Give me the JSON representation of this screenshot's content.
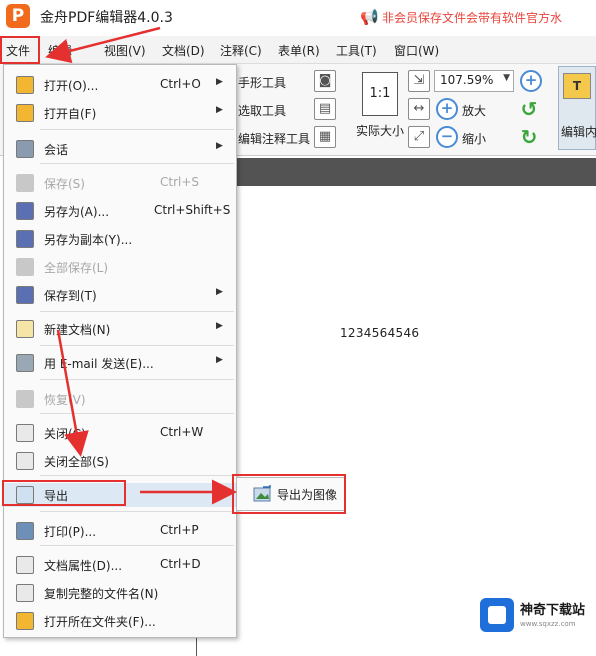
{
  "app": {
    "logo_letter": "P",
    "title": "金舟PDF编辑器4.0.3",
    "notice": "非会员保存文件会带有软件官方水"
  },
  "menubar": [
    "文件",
    "编辑",
    "视图(V)",
    "文档(D)",
    "注释(C)",
    "表单(R)",
    "工具(T)",
    "窗口(W)"
  ],
  "ribbon": {
    "hand_tool": "手形工具",
    "select_tool": "选取工具",
    "edit_annotation_tool": "编辑注释工具",
    "actual_size": "实际大小",
    "actual_size_icon_text": "1:1",
    "zoom_value": "107.59%",
    "zoom_in": "放大",
    "zoom_out": "缩小",
    "edit_content": "编辑内"
  },
  "file_menu": {
    "items": [
      {
        "label": "打开(O)...",
        "shortcut": "Ctrl+O",
        "submenu": true,
        "icon": "folder-open-icon",
        "disabled": false
      },
      {
        "label": "打开自(F)",
        "shortcut": "",
        "submenu": true,
        "icon": "folder-cloud-icon",
        "disabled": false
      },
      {
        "label": "会话",
        "shortcut": "",
        "submenu": true,
        "icon": "session-icon",
        "disabled": false
      },
      {
        "label": "保存(S)",
        "shortcut": "Ctrl+S",
        "submenu": false,
        "icon": "save-icon",
        "disabled": true
      },
      {
        "label": "另存为(A)...",
        "shortcut": "Ctrl+Shift+S",
        "submenu": false,
        "icon": "save-as-icon",
        "disabled": false
      },
      {
        "label": "另存为副本(Y)...",
        "shortcut": "",
        "submenu": false,
        "icon": "save-copy-icon",
        "disabled": false
      },
      {
        "label": "全部保存(L)",
        "shortcut": "",
        "submenu": false,
        "icon": "save-all-icon",
        "disabled": true
      },
      {
        "label": "保存到(T)",
        "shortcut": "",
        "submenu": true,
        "icon": "save-to-icon",
        "disabled": false
      },
      {
        "label": "新建文档(N)",
        "shortcut": "",
        "submenu": true,
        "icon": "new-document-icon",
        "disabled": false
      },
      {
        "label": "用 E-mail 发送(E)...",
        "shortcut": "",
        "submenu": true,
        "icon": "email-icon",
        "disabled": false
      },
      {
        "label": "恢复(V)",
        "shortcut": "",
        "submenu": false,
        "icon": "restore-icon",
        "disabled": true
      },
      {
        "label": "关闭(C)",
        "shortcut": "Ctrl+W",
        "submenu": false,
        "icon": "close-document-icon",
        "disabled": false
      },
      {
        "label": "关闭全部(S)",
        "shortcut": "",
        "submenu": false,
        "icon": "close-all-icon",
        "disabled": false
      },
      {
        "label": "导出",
        "shortcut": "",
        "submenu": true,
        "icon": "export-icon",
        "disabled": false
      },
      {
        "label": "打印(P)...",
        "shortcut": "Ctrl+P",
        "submenu": false,
        "icon": "print-icon",
        "disabled": false
      },
      {
        "label": "文档属性(D)...",
        "shortcut": "Ctrl+D",
        "submenu": false,
        "icon": "document-properties-icon",
        "disabled": false
      },
      {
        "label": "复制完整的文件名(N)",
        "shortcut": "",
        "submenu": false,
        "icon": "copy-filename-icon",
        "disabled": false
      },
      {
        "label": "打开所在文件夹(F)...",
        "shortcut": "",
        "submenu": false,
        "icon": "open-folder-icon",
        "disabled": false
      }
    ]
  },
  "export_submenu": {
    "label": "导出为图像"
  },
  "document": {
    "text": "1234564546"
  },
  "watermark": {
    "name": "神奇下载站",
    "url": "www.sqxzz.com"
  },
  "colors": {
    "accent": "#e53030",
    "brand": "#f26a1b",
    "menu_active": "#dde8f5"
  }
}
